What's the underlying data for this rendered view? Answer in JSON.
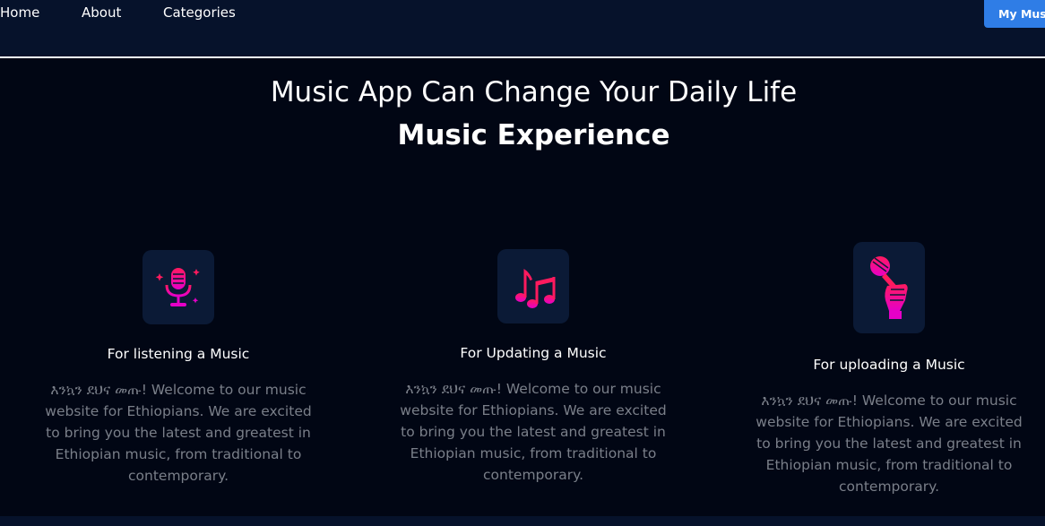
{
  "nav": {
    "links": [
      "Home",
      "About",
      "Categories"
    ],
    "cta_label": "My Music"
  },
  "hero": {
    "title": "Music App Can Change Your Daily Life",
    "subtitle": "Music Experience"
  },
  "features": [
    {
      "icon": "microphone-icon",
      "title": "For listening a Music",
      "description": "እንኳን ደህና መጡ! Welcome to our music website for Ethiopians. We are excited to bring you the latest and greatest in Ethiopian music, from traditional to contemporary."
    },
    {
      "icon": "music-notes-icon",
      "title": "For Updating a Music",
      "description": "እንኳን ደህና መጡ! Welcome to our music website for Ethiopians. We are excited to bring you the latest and greatest in Ethiopian music, from traditional to contemporary."
    },
    {
      "icon": "karaoke-microphone-icon",
      "title": "For uploading a Music",
      "description": "እንኳን ደህና መጡ! Welcome to our music website for Ethiopians. We are excited to bring you the latest and greatest in Ethiopian music, from traditional to contemporary."
    }
  ],
  "colors": {
    "background": "#010614",
    "navbar": "#06122b",
    "button": "#2f7de6",
    "icon_gradient_start": "#ff1a5e",
    "icon_gradient_end": "#e600c8",
    "muted_text": "#7a7f89"
  }
}
